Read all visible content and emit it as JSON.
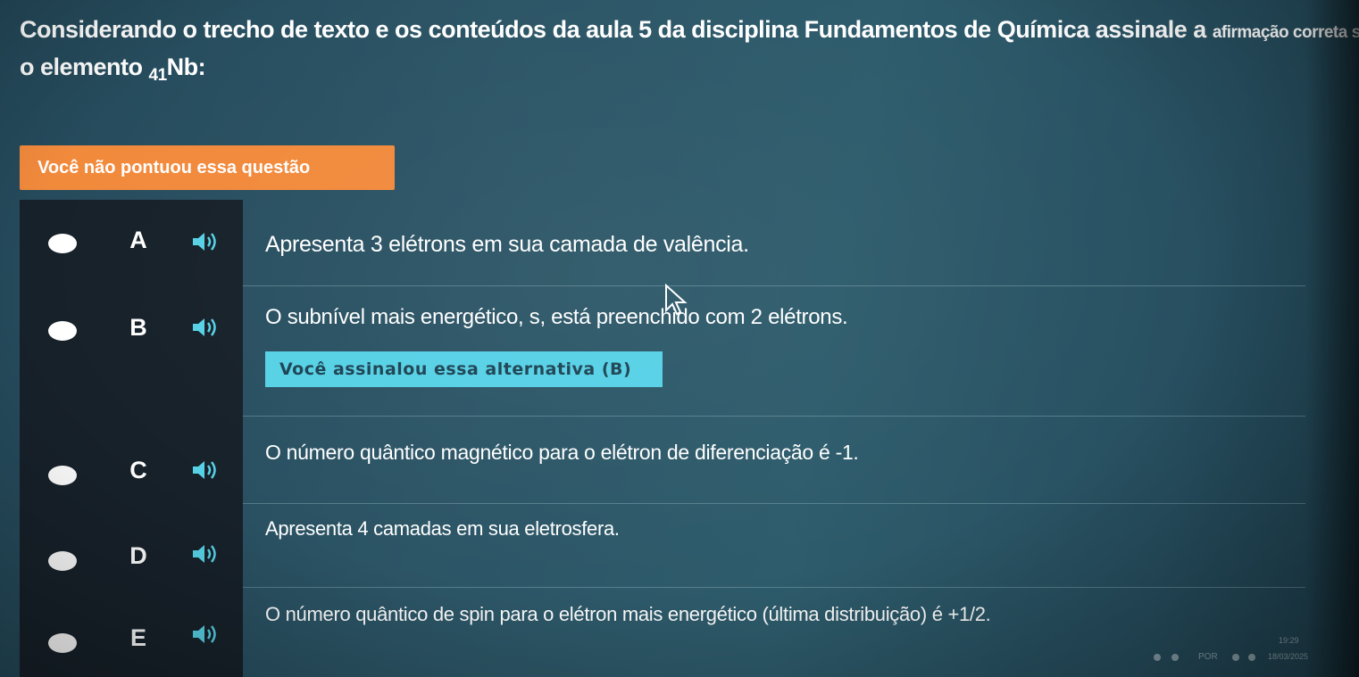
{
  "question": {
    "line1": "Considerando o trecho de texto e os conteúdos da aula 5 da disciplina Fundamentos de Química assinale a",
    "line1_tail": "afirmação correta sobre",
    "line2_prefix": "o elemento ",
    "subscript": "41",
    "line2_suffix": "Nb:"
  },
  "status_badge": "Você não pontuou essa questão",
  "options": [
    {
      "letter": "A",
      "text": "Apresenta 3 elétrons em sua camada de valência."
    },
    {
      "letter": "B",
      "text": "O subnível mais energético, s, está preenchido com 2 elétrons."
    },
    {
      "letter": "C",
      "text": "O número quântico magnético para o elétron de diferenciação é -1."
    },
    {
      "letter": "D",
      "text": "Apresenta 4 camadas em sua eletrosfera."
    },
    {
      "letter": "E",
      "text": "O número quântico de spin para o elétron mais energético (última distribuição) é +1/2."
    }
  ],
  "selected_badge": "Você assinalou essa alternativa (B)",
  "taskbar": {
    "lang": "POR",
    "time": "19:29",
    "date": "18/03/2025"
  },
  "colors": {
    "warning": "#f28a3c",
    "selected": "#57d1e6",
    "left_column": "#17212a"
  }
}
